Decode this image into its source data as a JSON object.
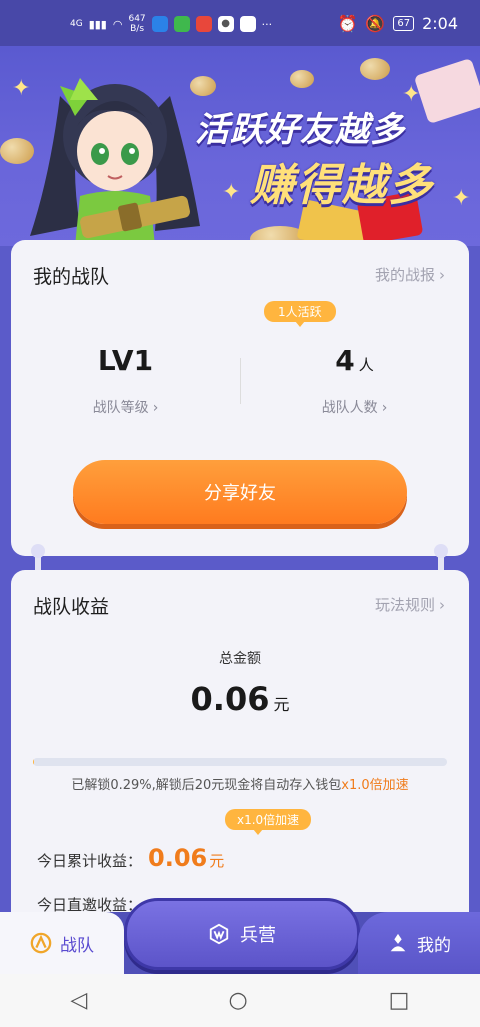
{
  "status_bar": {
    "net_type": "4G",
    "net_speed_value": "647",
    "net_speed_unit": "B/s",
    "battery": "67",
    "time": "2:04"
  },
  "banner": {
    "line1": "活跃好友越多",
    "line2": "赚得越多"
  },
  "team_card": {
    "title": "我的战队",
    "report_link": "我的战报",
    "active_badge": "1人活跃",
    "level_value": "LV1",
    "level_label": "战队等级",
    "members_value": "4",
    "members_unit": "人",
    "members_label": "战队人数",
    "share_button": "分享好友"
  },
  "earnings_card": {
    "title": "战队收益",
    "rules_link": "玩法规则",
    "total_label": "总金额",
    "total_value": "0.06",
    "total_unit": "元",
    "unlock_progress_percent": 0.29,
    "unlock_note_prefix": "已解锁0.29%,解锁后20元现金将自动存入钱包",
    "unlock_note_highlight": "x1.0倍加速",
    "multiplier_badge": "x1.0倍加速",
    "today_cumulative_label": "今日累计收益：",
    "today_cumulative_value": "0.06",
    "today_cumulative_unit": "元",
    "today_direct_label": "今日直邀收益："
  },
  "tabs": {
    "team": "战队",
    "camp": "兵营",
    "mine": "我的"
  },
  "colors": {
    "primary": "#5b5bc9",
    "accent_orange": "#ff8a2a",
    "badge_yellow": "#ffb53f"
  }
}
